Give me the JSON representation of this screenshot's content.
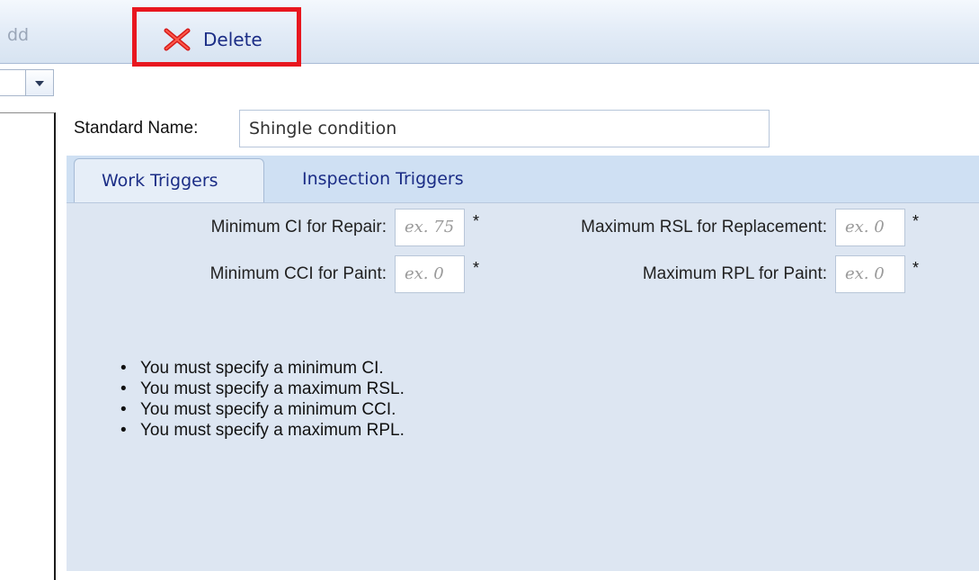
{
  "toolbar": {
    "add_label": "dd",
    "delete_label": "Delete",
    "delete_icon": "red-x-icon"
  },
  "form": {
    "standard_name_label": "Standard Name:",
    "standard_name_value": "Shingle condition"
  },
  "tabs": [
    {
      "label": "Work Triggers",
      "active": true
    },
    {
      "label": "Inspection Triggers",
      "active": false
    }
  ],
  "work_triggers": {
    "fields": [
      {
        "label": "Minimum CI for Repair:",
        "placeholder": "ex. 75",
        "required_mark": "*"
      },
      {
        "label": "Maximum RSL for Replacement:",
        "placeholder": "ex. 0",
        "required_mark": "*"
      },
      {
        "label": "Minimum CCI for Paint:",
        "placeholder": "ex. 0",
        "required_mark": "*"
      },
      {
        "label": "Maximum RPL for Paint:",
        "placeholder": "ex. 0",
        "required_mark": "*"
      }
    ],
    "validation_messages": [
      "You must specify a minimum CI.",
      "You must specify a maximum RSL.",
      "You must specify a minimum CCI.",
      "You must specify a maximum RPL."
    ]
  },
  "colors": {
    "highlight": "#e8171f",
    "tab_text": "#1b2d86",
    "panel_bg": "#dde6f2"
  }
}
